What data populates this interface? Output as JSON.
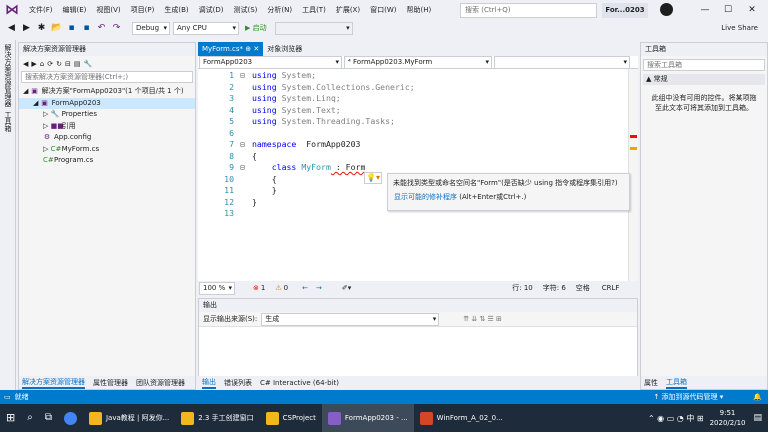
{
  "menu": [
    "文件(F)",
    "编辑(E)",
    "视图(V)",
    "项目(P)",
    "生成(B)",
    "调试(D)",
    "测试(S)",
    "分析(N)",
    "工具(T)",
    "扩展(X)",
    "窗口(W)",
    "帮助(H)"
  ],
  "search_placeholder": "搜索 (Ctrl+Q)",
  "project_title": "For...0203",
  "toolbar": {
    "config": "Debug",
    "platform": "Any CPU",
    "start": "▶ 启动",
    "live_share": "Live Share"
  },
  "left_strip": [
    "解决方案资源管理器",
    "工具箱"
  ],
  "solution_explorer": {
    "title": "解决方案资源管理器",
    "search": "搜索解决方案资源管理器(Ctrl+;)",
    "items": [
      {
        "label": "解决方案\"FormApp0203\"(1 个项目/共 1 个)",
        "indent": 0
      },
      {
        "label": "FormApp0203",
        "indent": 1
      },
      {
        "label": "Properties",
        "indent": 2
      },
      {
        "label": "引用",
        "indent": 2
      },
      {
        "label": "App.config",
        "indent": 2
      },
      {
        "label": "MyForm.cs",
        "indent": 2
      },
      {
        "label": "Program.cs",
        "indent": 2
      }
    ],
    "bottom_tabs": [
      "解决方案资源管理器",
      "属性管理器",
      "团队资源管理器"
    ]
  },
  "editor": {
    "tabs": [
      "MyForm.cs*",
      "对象浏览器"
    ],
    "nav": [
      "FormApp0203",
      "⁴ FormApp0203.MyForm",
      ""
    ],
    "lines": [
      {
        "n": "1",
        "parts": [
          [
            "kw",
            "using"
          ],
          [
            "gray",
            " System;"
          ]
        ]
      },
      {
        "n": "2",
        "parts": [
          [
            "kw",
            "using"
          ],
          [
            "gray",
            " System.Collections.Generic;"
          ]
        ]
      },
      {
        "n": "3",
        "parts": [
          [
            "kw",
            "using"
          ],
          [
            "gray",
            " System.Linq;"
          ]
        ]
      },
      {
        "n": "4",
        "parts": [
          [
            "kw",
            "using"
          ],
          [
            "gray",
            " System.Text;"
          ]
        ]
      },
      {
        "n": "5",
        "parts": [
          [
            "kw",
            "using"
          ],
          [
            "gray",
            " System.Threading.Tasks;"
          ]
        ]
      },
      {
        "n": "6",
        "parts": []
      },
      {
        "n": "7",
        "parts": [
          [
            "kw",
            "namespace"
          ],
          [
            "",
            "  FormApp0203"
          ]
        ]
      },
      {
        "n": "8",
        "parts": [
          [
            "",
            "{"
          ]
        ]
      },
      {
        "n": "9",
        "parts": [
          [
            "",
            "    "
          ],
          [
            "kw",
            "class"
          ],
          [
            "",
            " "
          ],
          [
            "ty",
            "MyForm"
          ],
          [
            "",
            " : Form"
          ]
        ]
      },
      {
        "n": "10",
        "parts": [
          [
            "",
            "    {"
          ]
        ]
      },
      {
        "n": "11",
        "parts": [
          [
            "",
            "    }"
          ]
        ]
      },
      {
        "n": "12",
        "parts": [
          [
            "",
            "}"
          ]
        ]
      },
      {
        "n": "13",
        "parts": []
      }
    ],
    "tooltip_error": "未能找到类型或命名空间名\"Form\"(是否缺少 using 指令或程序集引用?)",
    "tooltip_fix": "显示可能的修补程序",
    "tooltip_fix_hint": "(Alt+Enter或Ctrl+.)",
    "zoom": "100 %",
    "errors": "1",
    "warnings": "0",
    "line": "行: 10",
    "char": "字符: 6",
    "mode": "空格",
    "eol": "CRLF"
  },
  "output": {
    "title": "输出",
    "source_label": "显示输出来源(S):",
    "source_value": "生成",
    "bottom_tabs": [
      "输出",
      "错误列表",
      "C# Interactive (64-bit)"
    ]
  },
  "toolbox": {
    "title": "工具箱",
    "search": "搜索工具箱",
    "section": "▲ 常规",
    "empty_message": "此组中没有可用的控件。将某项拖至此文本可将其添加到工具箱。",
    "bottom_tabs": [
      "属性",
      "工具箱"
    ]
  },
  "status": {
    "ready": "就绪",
    "source_control": "↑ 添加到源代码管理 ▾"
  },
  "taskbar": {
    "items": [
      {
        "label": "Java教程 | 阿发你...",
        "color": "#f3b71e"
      },
      {
        "label": "2.3 手工创建窗口",
        "color": "#f3b71e"
      },
      {
        "label": "CSProject",
        "color": "#f3b71e"
      },
      {
        "label": "FormApp0203 - ...",
        "color": "#865fc5"
      },
      {
        "label": "WinForm_A_02_0...",
        "color": "#d24726"
      }
    ],
    "time": "9:51",
    "date": "2020/2/10"
  }
}
